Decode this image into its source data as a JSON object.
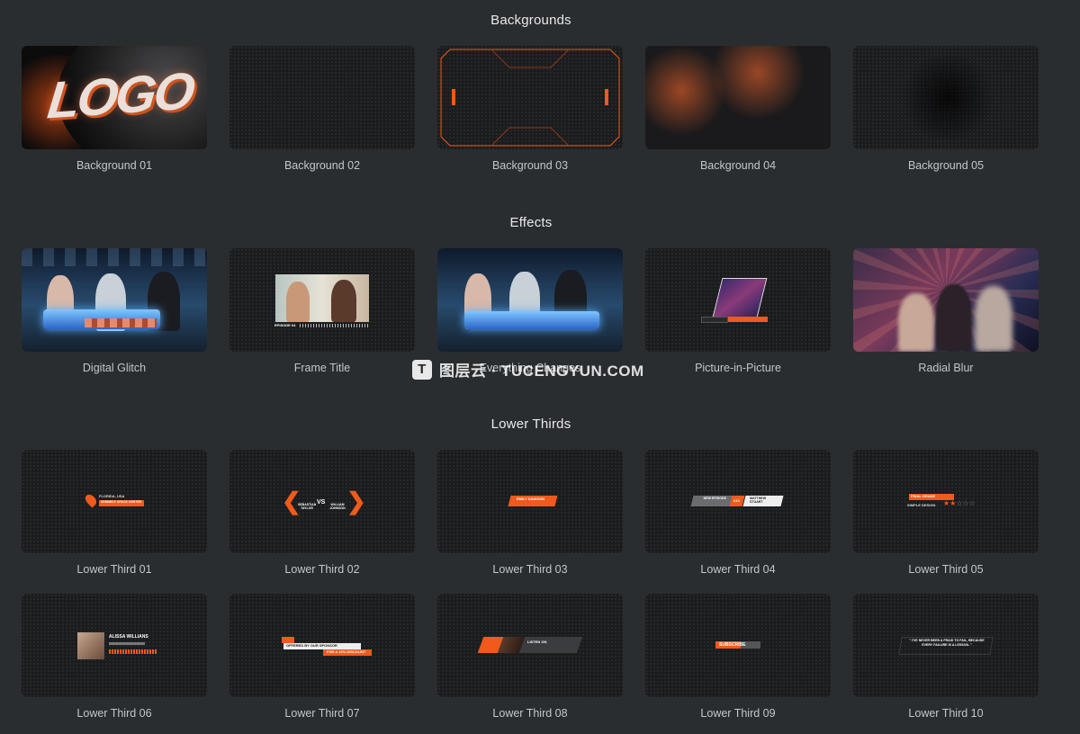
{
  "sections": [
    {
      "title": "Backgrounds",
      "items": [
        "Background 01",
        "Background 02",
        "Background 03",
        "Background 04",
        "Background 05"
      ]
    },
    {
      "title": "Effects",
      "items": [
        "Digital Glitch",
        "Frame Title",
        "Everything Changes",
        "Picture-in-Picture",
        "Radial Blur"
      ]
    },
    {
      "title": "Lower Thirds",
      "items": [
        "Lower Third 01",
        "Lower Third 02",
        "Lower Third 03",
        "Lower Third 04",
        "Lower Third 05",
        "Lower Third 06",
        "Lower Third 07",
        "Lower Third 08",
        "Lower Third 09",
        "Lower Third 10"
      ]
    }
  ],
  "thumb_text": {
    "logo": "LOGO",
    "episode": "EPISODE 04",
    "lt01_line1": "FLORIDA, USA",
    "lt01_line2": "KENNEDY SPACE CENTER",
    "lt02_left": "SEBASTIAN TAYLOR",
    "lt02_vs": "VS",
    "lt02_right": "WILLIAM JOHNSON",
    "lt03_name": "EMILY DAWSON",
    "lt04_new": "NEW EPISODE",
    "lt04_num": "#10",
    "lt04_name": "MATTHEW STUART",
    "lt05_title": "FINAL GRADE",
    "lt05_sub": "SIMPLE DESIGN",
    "lt06_name": "ALISSA WILLIANS",
    "lt07_line1": "OFFERED BY OUR SPONSOR",
    "lt07_line2": "FOR A 10% DISCOUNT",
    "lt08_title": "LISTEN ON",
    "lt09_text": "SUBSCRIBE",
    "lt10_quote": "\" I'VE NEVER BEEN A FRAID TO FAIL, BECAUSE EVERY FAILURE IS A LESSON. \""
  },
  "watermark": {
    "icon": "T",
    "text": "图层云 · TUCENGYUN.COM"
  },
  "accent_color": "#f05a1c"
}
